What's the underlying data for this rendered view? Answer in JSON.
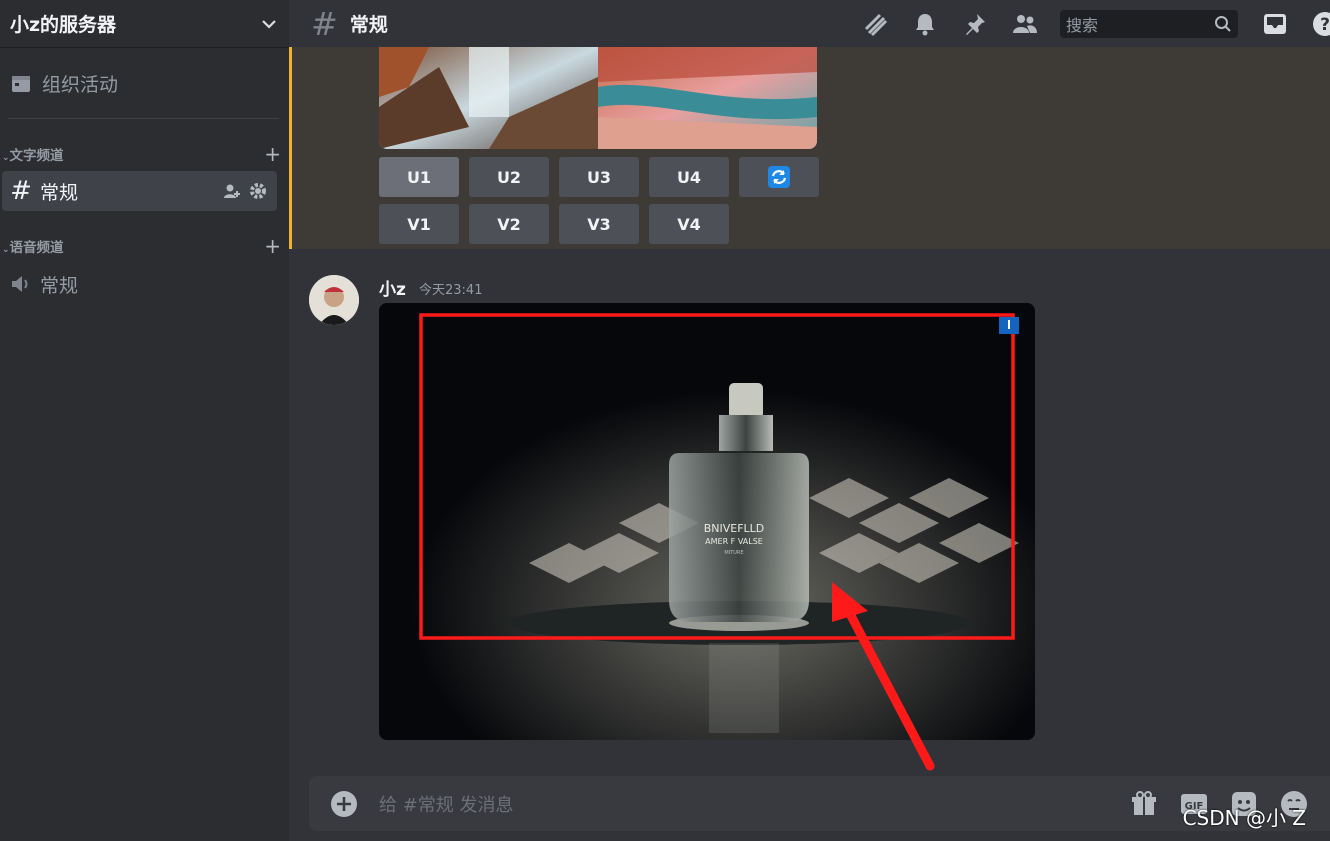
{
  "server": {
    "name": "小z的服务器"
  },
  "sidebar": {
    "events_label": "组织活动",
    "categories": [
      {
        "label": "文字频道",
        "channels": [
          {
            "name": "常规",
            "active": true
          }
        ]
      },
      {
        "label": "语音频道",
        "channels": [
          {
            "name": "常规",
            "active": false
          }
        ]
      }
    ]
  },
  "topbar": {
    "channel_name": "常规",
    "search_placeholder": "搜索"
  },
  "messages": {
    "upscale_buttons": [
      "U1",
      "U2",
      "U3",
      "U4"
    ],
    "variation_buttons": [
      "V1",
      "V2",
      "V3",
      "V4"
    ],
    "reroll_icon": "refresh-icon",
    "latest": {
      "author": "小z",
      "timestamp": "今天23:41"
    },
    "bottle_text": [
      "BNIVEFLLD",
      "AMER F VALSE",
      "MITURE"
    ]
  },
  "composer": {
    "placeholder": "给 #常规 发消息"
  },
  "watermark": "CSDN @小 Z",
  "colors": {
    "accent_highlight": "#f0b232",
    "annotation_red": "#ff1a1a",
    "reroll_blue": "#1e88e5"
  }
}
